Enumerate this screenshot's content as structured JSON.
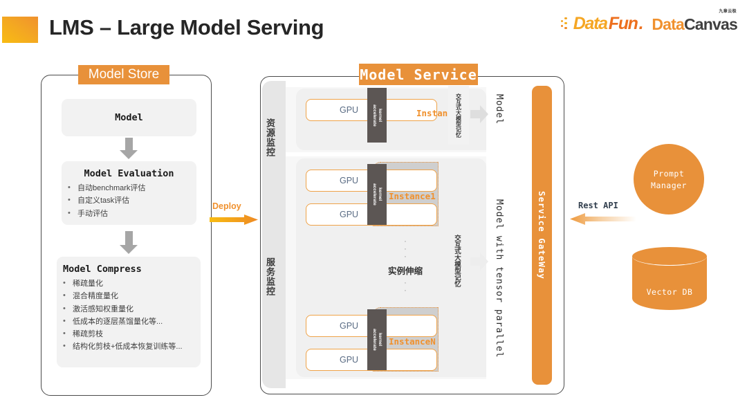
{
  "header": {
    "title": "LMS – Large Model Serving",
    "logos": {
      "datafun": {
        "part1": "Data",
        "part2": "Fun",
        "dot": "."
      },
      "datacanvas": {
        "cn": "九章云极",
        "part1": "Data",
        "part2": "Canvas"
      }
    }
  },
  "model_store": {
    "tab_label": "Model Store",
    "model_card": {
      "title": "Model"
    },
    "evaluation_card": {
      "title": "Model Evaluation",
      "bullets": [
        "自动benchmark评估",
        "自定义task评估",
        "手动评估"
      ]
    },
    "compress_card": {
      "title": "Model Compress",
      "bullets": [
        "稀疏量化",
        "混合精度量化",
        "激活感知权重量化",
        "低成本的逐层蒸馏量化等...",
        "稀疏剪枝",
        "结构化剪枝+低成本恢复训练等..."
      ]
    }
  },
  "deploy": {
    "label": "Deploy"
  },
  "model_service": {
    "tab_label": "Model Service",
    "monitors": {
      "resource": "资源监控",
      "service": "服务监控"
    },
    "gpu_label": "GPU",
    "kernel_label": "kernel\naccelerate",
    "instances": {
      "top": "Instance",
      "first": "Instance1",
      "last": "InstanceN"
    },
    "memory_label": "交互式大模型记忆",
    "scaling": {
      "label": "实例伸缩",
      "dots": "·"
    },
    "vertical_labels": {
      "model": "Model",
      "tensor_parallel": "Model with tensor parallel"
    },
    "gateway_label": "Service GateWay"
  },
  "right_column": {
    "prompt_manager": {
      "line1": "Prompt",
      "line2": "Manager"
    },
    "vector_db": {
      "label": "Vector DB"
    },
    "rest_api": {
      "label": "Rest API"
    }
  },
  "colors": {
    "orange": "#E8913A",
    "orange_bright": "#F0912E",
    "yellow": "#F8BC12",
    "grey_dark": "#5C5654",
    "grey_card": "#F2F2F2",
    "text_dark": "#262626"
  }
}
